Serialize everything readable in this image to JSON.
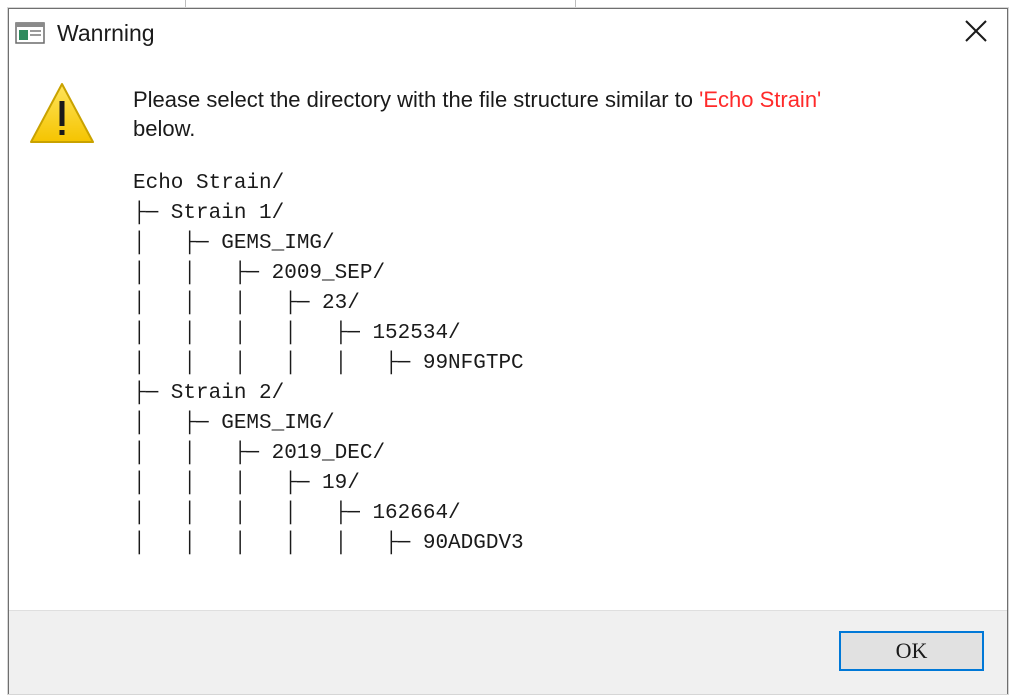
{
  "window": {
    "title": "Wanrning",
    "icons": {
      "app": "window-app-icon",
      "close": "close-icon",
      "warning": "warning-triangle-icon"
    }
  },
  "message": {
    "text_before": "Please select the directory with the file structure similar to ",
    "highlight": "'Echo Strain'",
    "text_after": "below.",
    "highlight_color": "#ff2a2a"
  },
  "tree": [
    "Echo Strain/",
    "├─ Strain 1/",
    "│   ├─ GEMS_IMG/",
    "│   │   ├─ 2009_SEP/",
    "│   │   │   ├─ 23/",
    "│   │   │   │   ├─ 152534/",
    "│   │   │   │   │   ├─ 99NFGTPC",
    "├─ Strain 2/",
    "│   ├─ GEMS_IMG/",
    "│   │   ├─ 2019_DEC/",
    "│   │   │   ├─ 19/",
    "│   │   │   │   ├─ 162664/",
    "│   │   │   │   │   ├─ 90ADGDV3"
  ],
  "buttons": {
    "ok": "OK"
  },
  "colors": {
    "accent_border": "#0078d7",
    "footer_bg": "#f0f0f0",
    "warning_fill": "#fcd116"
  }
}
